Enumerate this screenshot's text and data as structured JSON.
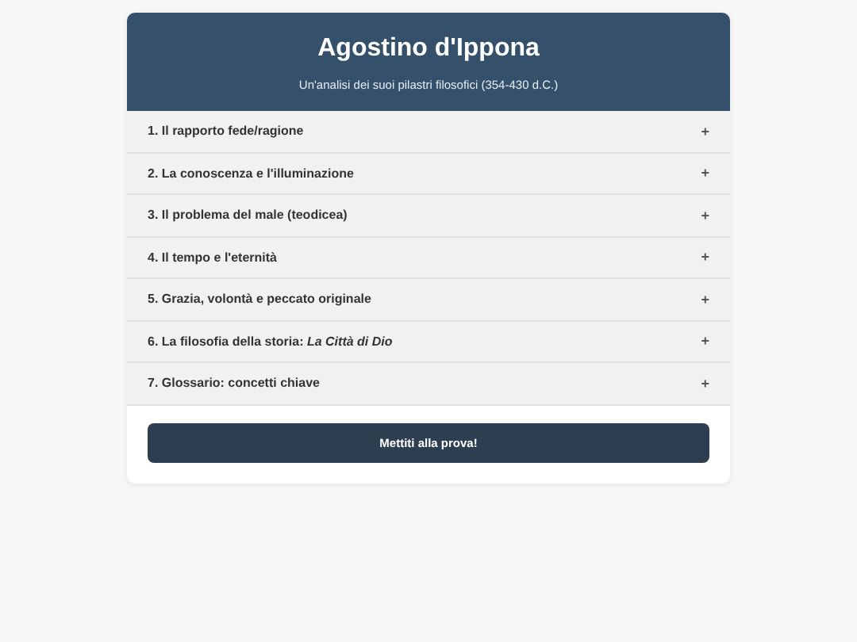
{
  "header": {
    "title": "Agostino d'Ippona",
    "subtitle": "Un'analisi dei suoi pilastri filosofici (354-430 d.C.)"
  },
  "sections": [
    {
      "label": "1. Il rapporto fede/ragione",
      "toggle": "+"
    },
    {
      "label": "2. La conoscenza e l'illuminazione",
      "toggle": "+"
    },
    {
      "label": "3. Il problema del male (teodicea)",
      "toggle": "+"
    },
    {
      "label": "4. Il tempo e l'eternità",
      "toggle": "+"
    },
    {
      "label": "5. Grazia, volontà e peccato originale",
      "toggle": "+"
    },
    {
      "label": "6. La filosofia della storia: *La Città di Dio*",
      "toggle": "+"
    },
    {
      "label": "7. Glossario: concetti chiave",
      "toggle": "+"
    }
  ],
  "quiz_button": "Mettiti alla prova!"
}
